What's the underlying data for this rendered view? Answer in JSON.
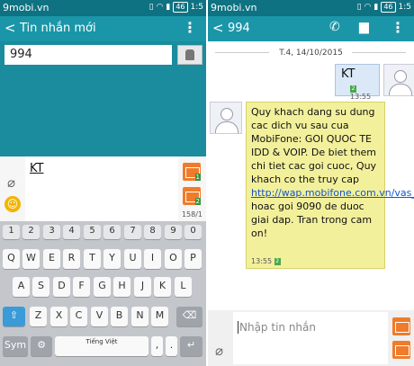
{
  "left": {
    "status": {
      "site": "9mobi.vn",
      "battery": "46",
      "time": "1:5"
    },
    "appbar": {
      "title": "Tin nhắn mới"
    },
    "recipient": {
      "value": "994"
    },
    "composer": {
      "text": "KT",
      "count": "158/1",
      "sim1": "1",
      "sim2": "2"
    },
    "keyboard": {
      "numbers": [
        "1",
        "2",
        "3",
        "4",
        "5",
        "6",
        "7",
        "8",
        "9",
        "0"
      ],
      "row1": [
        "Q",
        "W",
        "E",
        "R",
        "T",
        "Y",
        "U",
        "I",
        "O",
        "P"
      ],
      "row2": [
        "A",
        "S",
        "D",
        "F",
        "G",
        "H",
        "J",
        "K",
        "L"
      ],
      "row3": [
        "Z",
        "X",
        "C",
        "V",
        "B",
        "N",
        "M"
      ],
      "sym": "Sym",
      "space": "Tiếng Việt",
      "comma": ",",
      ".": ".",
      "shift": "⇧",
      "backspace": "⌫",
      "enter": "↵",
      "gear": "⚙"
    }
  },
  "right": {
    "status": {
      "site": "9mobi.vn",
      "battery": "46",
      "time": "1:5"
    },
    "appbar": {
      "title": "994"
    },
    "date": "T.4, 14/10/2015",
    "outgoing": {
      "text": "KT",
      "time": "13:55",
      "sim": "2"
    },
    "incoming": {
      "text1": "Quy khach dang su dung cac dich vu sau cua MobiFone: GOI QUOC TE IDD & VOIP. De biet them chi tiet cac goi cuoc, Quy khach co the truy cap ",
      "link": "http://wap.mobifone.com.vn/vas_register/",
      "text2": " hoac goi 9090 de duoc giai dap. Tran trong cam on!",
      "time": "13:55",
      "sim": "2"
    },
    "composer": {
      "placeholder": "Nhập tin nhắn"
    }
  }
}
